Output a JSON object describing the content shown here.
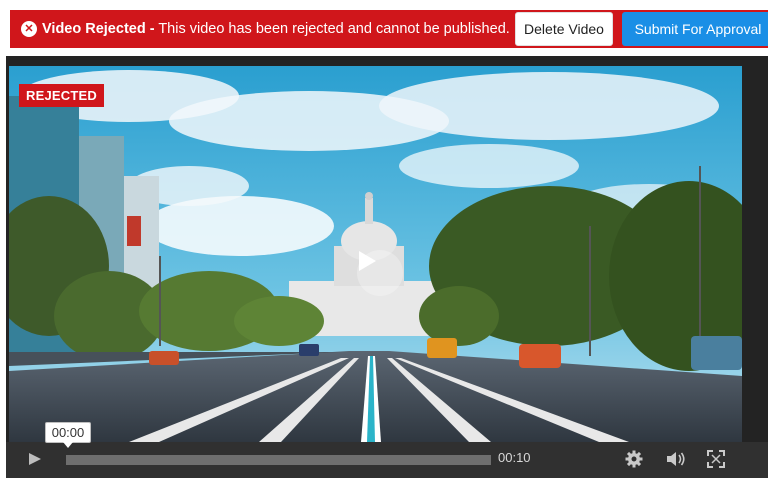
{
  "banner": {
    "status_title": "Video Rejected -",
    "status_message": " This video has been rejected and cannot be published.",
    "status_icon": "close-circle-icon",
    "delete_button": "Delete Video",
    "submit_button": "Submit For Approval",
    "colors": {
      "banner": "#d0161b",
      "submit": "#1a8fe6"
    }
  },
  "player": {
    "badge": "REJECTED",
    "current_time": "00:00",
    "duration": "00:10",
    "progress": 0,
    "icons": [
      "play-icon",
      "settings-gear-icon",
      "volume-icon",
      "fullscreen-icon",
      "play-overlay-icon"
    ]
  }
}
